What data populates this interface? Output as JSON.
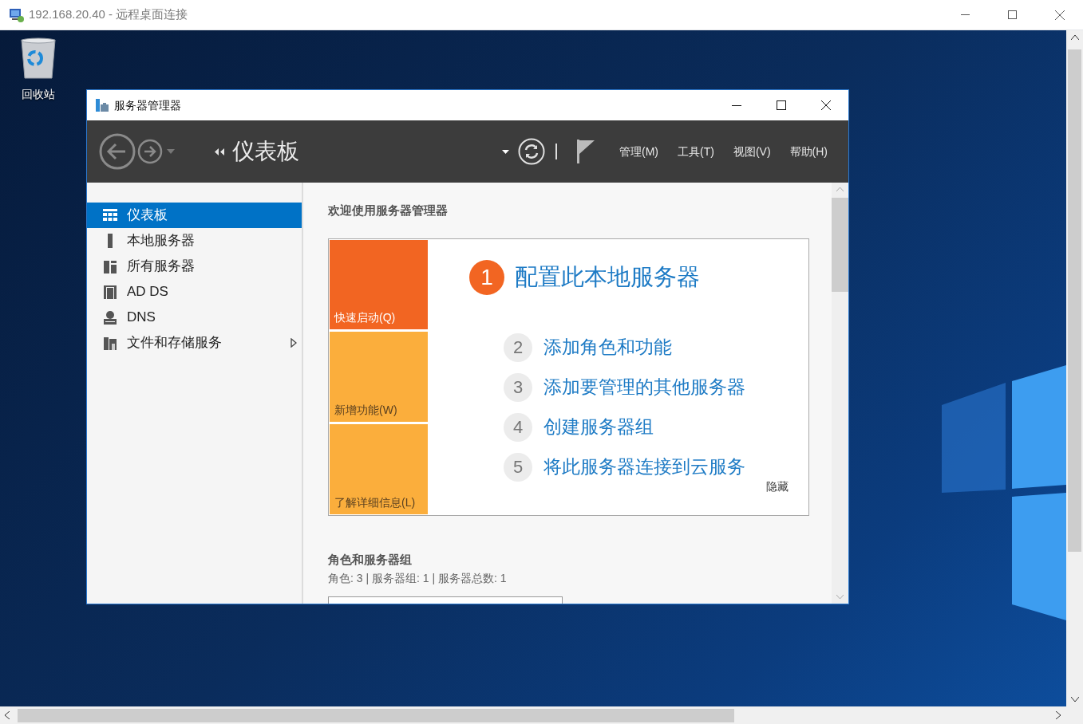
{
  "rdp_window": {
    "title": "192.168.20.40 - 远程桌面连接"
  },
  "desktop_icons": [
    {
      "label": "回收站"
    }
  ],
  "server_manager": {
    "title": "服务器管理器",
    "header": {
      "breadcrumb": "仪表板",
      "menu": [
        "管理(M)",
        "工具(T)",
        "视图(V)",
        "帮助(H)"
      ]
    },
    "sidebar": {
      "items": [
        {
          "kind": "dashboard",
          "label": "仪表板",
          "selected": true,
          "expandable": false
        },
        {
          "kind": "server",
          "label": "本地服务器",
          "selected": false,
          "expandable": false
        },
        {
          "kind": "servers",
          "label": "所有服务器",
          "selected": false,
          "expandable": false
        },
        {
          "kind": "adds",
          "label": "AD DS",
          "selected": false,
          "expandable": false
        },
        {
          "kind": "dns",
          "label": "DNS",
          "selected": false,
          "expandable": false
        },
        {
          "kind": "storage",
          "label": "文件和存储服务",
          "selected": false,
          "expandable": true
        }
      ]
    },
    "welcome_title": "欢迎使用服务器管理器",
    "quick_start_tiles": [
      {
        "label": "快速启动(Q)",
        "selected": true
      },
      {
        "label": "新增功能(W)",
        "selected": false
      },
      {
        "label": "了解详细信息(L)",
        "selected": false
      }
    ],
    "steps": [
      {
        "number": "1",
        "label": "配置此本地服务器",
        "selected": true
      },
      {
        "number": "2",
        "label": "添加角色和功能",
        "selected": false
      },
      {
        "number": "3",
        "label": "添加要管理的其他服务器",
        "selected": false
      },
      {
        "number": "4",
        "label": "创建服务器组",
        "selected": false
      },
      {
        "number": "5",
        "label": "将此服务器连接到云服务",
        "selected": false
      }
    ],
    "hide_link": "隐藏",
    "roles_section": {
      "title": "角色和服务器组",
      "summary": "角色: 3 | 服务器组: 1 | 服务器总数: 1"
    }
  }
}
